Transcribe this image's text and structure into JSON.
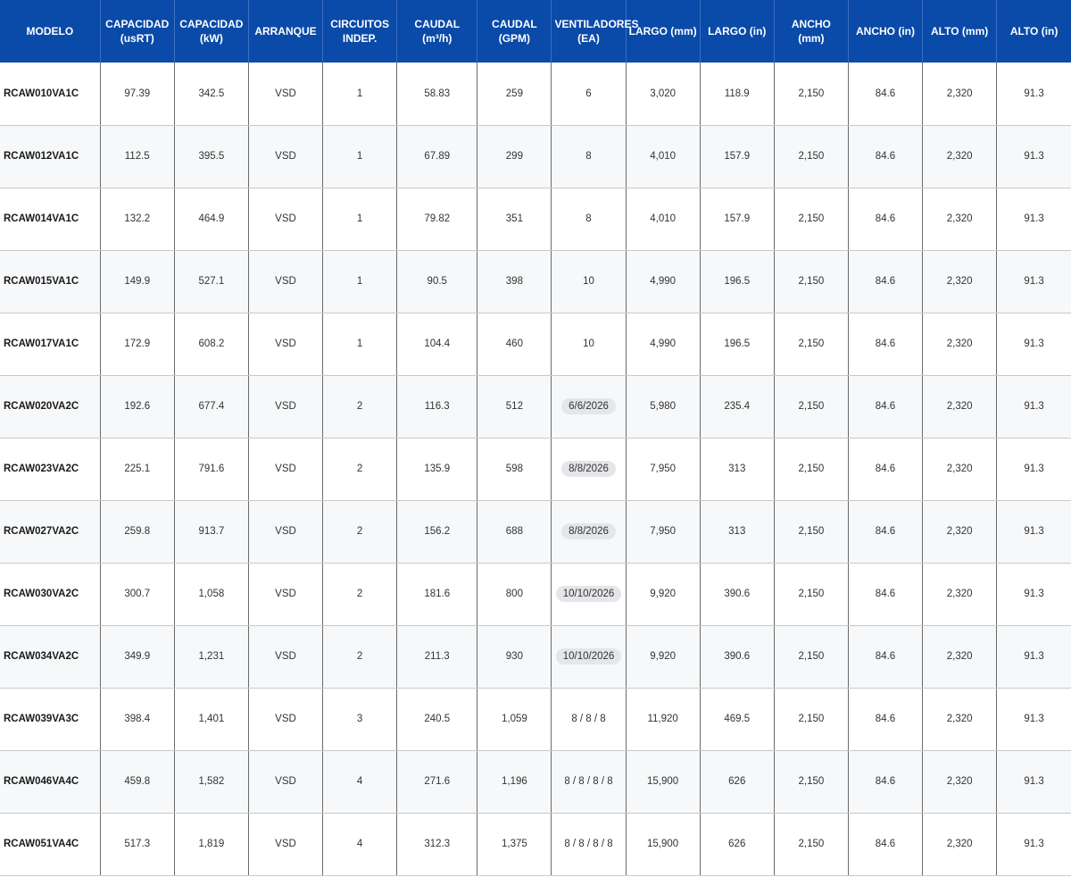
{
  "headers": [
    "MODELO",
    "CAPACIDAD (usRT)",
    "CAPACIDAD (kW)",
    "ARRANQUE",
    "CIRCUITOS INDEP.",
    "CAUDAL (m³/h)",
    "CAUDAL (GPM)",
    "VENTILADORES (EA)",
    "LARGO (mm)",
    "LARGO (in)",
    "ANCHO (mm)",
    "ANCHO (in)",
    "ALTO (mm)",
    "ALTO (in)"
  ],
  "rows": [
    {
      "model": "RCAW010VA1C",
      "cap_usrt": "97.39",
      "cap_kw": "342.5",
      "arranque": "VSD",
      "circuitos": "1",
      "caudal_m3h": "58.83",
      "caudal_gpm": "259",
      "ventiladores": "6",
      "ventiladores_chip": false,
      "largo_mm": "3,020",
      "largo_in": "118.9",
      "ancho_mm": "2,150",
      "ancho_in": "84.6",
      "alto_mm": "2,320",
      "alto_in": "91.3"
    },
    {
      "model": "RCAW012VA1C",
      "cap_usrt": "112.5",
      "cap_kw": "395.5",
      "arranque": "VSD",
      "circuitos": "1",
      "caudal_m3h": "67.89",
      "caudal_gpm": "299",
      "ventiladores": "8",
      "ventiladores_chip": false,
      "largo_mm": "4,010",
      "largo_in": "157.9",
      "ancho_mm": "2,150",
      "ancho_in": "84.6",
      "alto_mm": "2,320",
      "alto_in": "91.3"
    },
    {
      "model": "RCAW014VA1C",
      "cap_usrt": "132.2",
      "cap_kw": "464.9",
      "arranque": "VSD",
      "circuitos": "1",
      "caudal_m3h": "79.82",
      "caudal_gpm": "351",
      "ventiladores": "8",
      "ventiladores_chip": false,
      "largo_mm": "4,010",
      "largo_in": "157.9",
      "ancho_mm": "2,150",
      "ancho_in": "84.6",
      "alto_mm": "2,320",
      "alto_in": "91.3"
    },
    {
      "model": "RCAW015VA1C",
      "cap_usrt": "149.9",
      "cap_kw": "527.1",
      "arranque": "VSD",
      "circuitos": "1",
      "caudal_m3h": "90.5",
      "caudal_gpm": "398",
      "ventiladores": "10",
      "ventiladores_chip": false,
      "largo_mm": "4,990",
      "largo_in": "196.5",
      "ancho_mm": "2,150",
      "ancho_in": "84.6",
      "alto_mm": "2,320",
      "alto_in": "91.3"
    },
    {
      "model": "RCAW017VA1C",
      "cap_usrt": "172.9",
      "cap_kw": "608.2",
      "arranque": "VSD",
      "circuitos": "1",
      "caudal_m3h": "104.4",
      "caudal_gpm": "460",
      "ventiladores": "10",
      "ventiladores_chip": false,
      "largo_mm": "4,990",
      "largo_in": "196.5",
      "ancho_mm": "2,150",
      "ancho_in": "84.6",
      "alto_mm": "2,320",
      "alto_in": "91.3"
    },
    {
      "model": "RCAW020VA2C",
      "cap_usrt": "192.6",
      "cap_kw": "677.4",
      "arranque": "VSD",
      "circuitos": "2",
      "caudal_m3h": "116.3",
      "caudal_gpm": "512",
      "ventiladores": "6/6/2026",
      "ventiladores_chip": true,
      "largo_mm": "5,980",
      "largo_in": "235.4",
      "ancho_mm": "2,150",
      "ancho_in": "84.6",
      "alto_mm": "2,320",
      "alto_in": "91.3"
    },
    {
      "model": "RCAW023VA2C",
      "cap_usrt": "225.1",
      "cap_kw": "791.6",
      "arranque": "VSD",
      "circuitos": "2",
      "caudal_m3h": "135.9",
      "caudal_gpm": "598",
      "ventiladores": "8/8/2026",
      "ventiladores_chip": true,
      "largo_mm": "7,950",
      "largo_in": "313",
      "ancho_mm": "2,150",
      "ancho_in": "84.6",
      "alto_mm": "2,320",
      "alto_in": "91.3"
    },
    {
      "model": "RCAW027VA2C",
      "cap_usrt": "259.8",
      "cap_kw": "913.7",
      "arranque": "VSD",
      "circuitos": "2",
      "caudal_m3h": "156.2",
      "caudal_gpm": "688",
      "ventiladores": "8/8/2026",
      "ventiladores_chip": true,
      "largo_mm": "7,950",
      "largo_in": "313",
      "ancho_mm": "2,150",
      "ancho_in": "84.6",
      "alto_mm": "2,320",
      "alto_in": "91.3"
    },
    {
      "model": "RCAW030VA2C",
      "cap_usrt": "300.7",
      "cap_kw": "1,058",
      "arranque": "VSD",
      "circuitos": "2",
      "caudal_m3h": "181.6",
      "caudal_gpm": "800",
      "ventiladores": "10/10/2026",
      "ventiladores_chip": true,
      "largo_mm": "9,920",
      "largo_in": "390.6",
      "ancho_mm": "2,150",
      "ancho_in": "84.6",
      "alto_mm": "2,320",
      "alto_in": "91.3"
    },
    {
      "model": "RCAW034VA2C",
      "cap_usrt": "349.9",
      "cap_kw": "1,231",
      "arranque": "VSD",
      "circuitos": "2",
      "caudal_m3h": "211.3",
      "caudal_gpm": "930",
      "ventiladores": "10/10/2026",
      "ventiladores_chip": true,
      "largo_mm": "9,920",
      "largo_in": "390.6",
      "ancho_mm": "2,150",
      "ancho_in": "84.6",
      "alto_mm": "2,320",
      "alto_in": "91.3"
    },
    {
      "model": "RCAW039VA3C",
      "cap_usrt": "398.4",
      "cap_kw": "1,401",
      "arranque": "VSD",
      "circuitos": "3",
      "caudal_m3h": "240.5",
      "caudal_gpm": "1,059",
      "ventiladores": "8 / 8 / 8",
      "ventiladores_chip": false,
      "largo_mm": "11,920",
      "largo_in": "469.5",
      "ancho_mm": "2,150",
      "ancho_in": "84.6",
      "alto_mm": "2,320",
      "alto_in": "91.3"
    },
    {
      "model": "RCAW046VA4C",
      "cap_usrt": "459.8",
      "cap_kw": "1,582",
      "arranque": "VSD",
      "circuitos": "4",
      "caudal_m3h": "271.6",
      "caudal_gpm": "1,196",
      "ventiladores": "8 / 8 / 8 / 8",
      "ventiladores_chip": false,
      "largo_mm": "15,900",
      "largo_in": "626",
      "ancho_mm": "2,150",
      "ancho_in": "84.6",
      "alto_mm": "2,320",
      "alto_in": "91.3"
    },
    {
      "model": "RCAW051VA4C",
      "cap_usrt": "517.3",
      "cap_kw": "1,819",
      "arranque": "VSD",
      "circuitos": "4",
      "caudal_m3h": "312.3",
      "caudal_gpm": "1,375",
      "ventiladores": "8 / 8 / 8 / 8",
      "ventiladores_chip": false,
      "largo_mm": "15,900",
      "largo_in": "626",
      "ancho_mm": "2,150",
      "ancho_in": "84.6",
      "alto_mm": "2,320",
      "alto_in": "91.3"
    }
  ],
  "colors": {
    "header_bg": "#0a4aa8",
    "header_text": "#ffffff",
    "row_alt_bg": "#f6f8fa",
    "chip_bg": "#e4e6e9"
  }
}
